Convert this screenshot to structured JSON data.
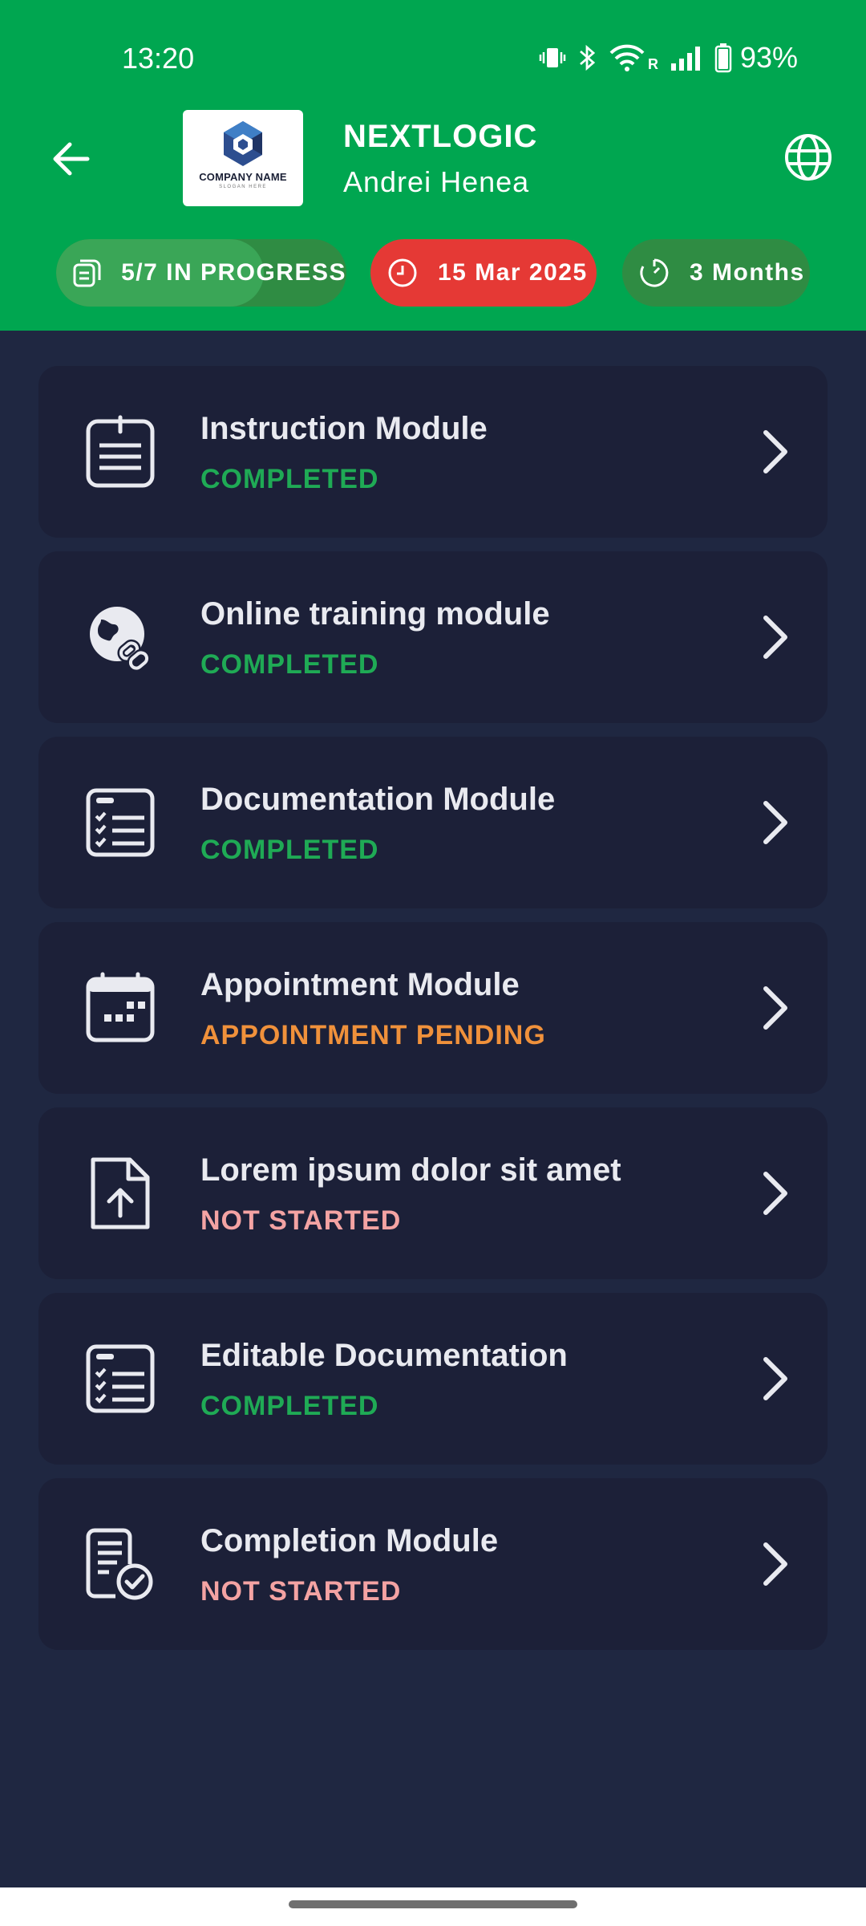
{
  "status_bar": {
    "time": "13:20",
    "battery": "93%",
    "network_label": "R",
    "icons": [
      "vibrate-icon",
      "bluetooth-icon",
      "wifi-icon",
      "signal-icon",
      "battery-icon"
    ]
  },
  "header": {
    "back_icon": "arrow-left-icon",
    "logo": {
      "name": "COMPANY NAME",
      "slogan": "SLOGAN HERE"
    },
    "company": "NEXTLOGIC",
    "user": "Andrei Henea",
    "language_icon": "globe-icon",
    "background_color": "#00a650"
  },
  "pills": {
    "progress": {
      "text": "5/7 IN PROGRESS",
      "completed": 5,
      "total": 7,
      "icon": "stack-icon"
    },
    "date": {
      "text": "15 Mar 2025",
      "icon": "clock-icon",
      "color": "#e53935"
    },
    "duration": {
      "text": "3 Months",
      "icon": "timer-icon"
    }
  },
  "modules": [
    {
      "title": "Instruction Module",
      "status": "COMPLETED",
      "status_color": "#1faa55",
      "icon": "notepad-icon"
    },
    {
      "title": "Online training module",
      "status": "COMPLETED",
      "status_color": "#1faa55",
      "icon": "globe-link-icon"
    },
    {
      "title": "Documentation Module",
      "status": "COMPLETED",
      "status_color": "#1faa55",
      "icon": "checklist-icon"
    },
    {
      "title": "Appointment Module",
      "status": "APPOINTMENT PENDING",
      "status_color": "#f0913b",
      "icon": "calendar-icon"
    },
    {
      "title": "Lorem ipsum dolor sit amet",
      "status": "NOT STARTED",
      "status_color": "#f4a3a3",
      "icon": "file-upload-icon"
    },
    {
      "title": "Editable Documentation",
      "status": "COMPLETED",
      "status_color": "#1faa55",
      "icon": "checklist-icon"
    },
    {
      "title": "Completion Module",
      "status": "NOT STARTED",
      "status_color": "#f4a3a3",
      "icon": "certificate-icon"
    }
  ],
  "colors": {
    "page_background": "#1f2741",
    "card_background": "#1c2038",
    "completed": "#1faa55",
    "pending": "#f0913b",
    "not_started": "#f4a3a3"
  }
}
